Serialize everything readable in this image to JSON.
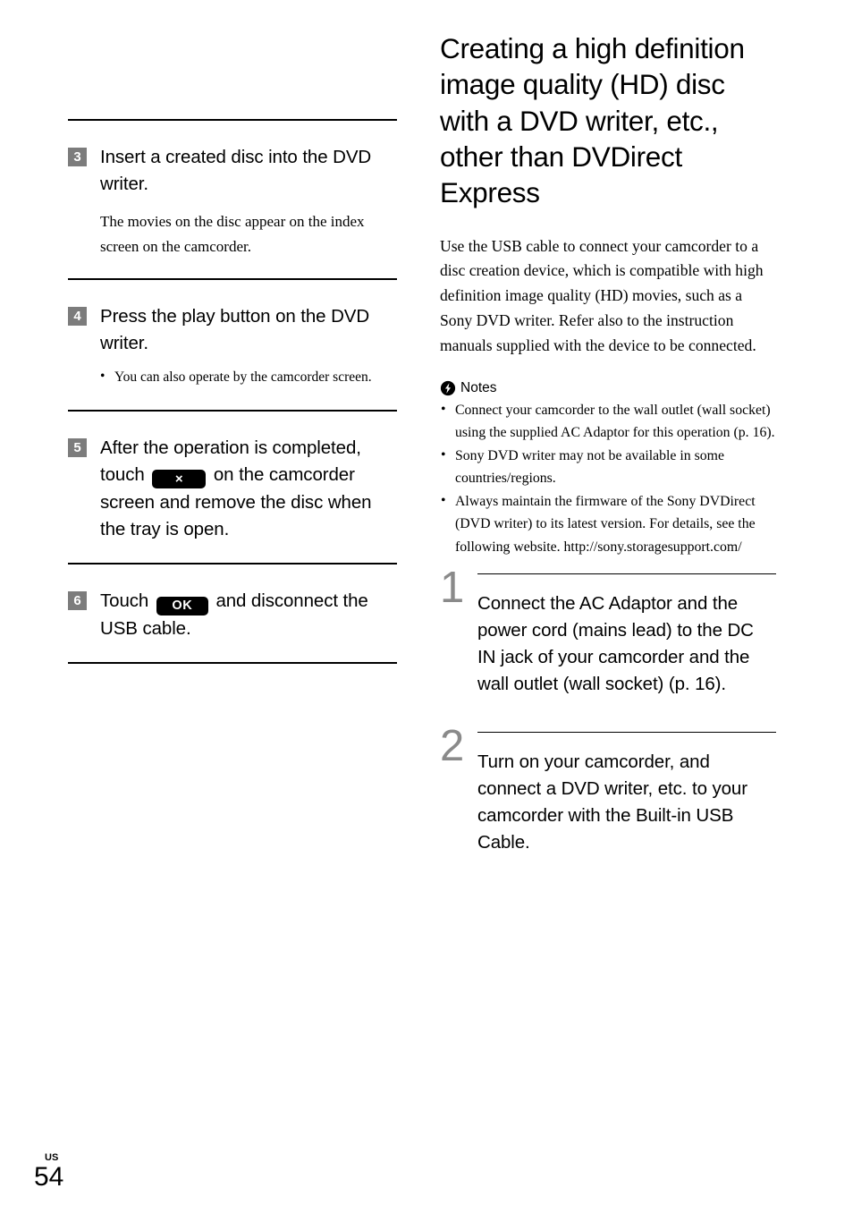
{
  "document": {
    "page_number": "54",
    "region_code": "US"
  },
  "left_column": {
    "steps": [
      {
        "number": "3",
        "heading": "Insert a created disc into the DVD writer.",
        "body": "The movies on the disc appear on the index screen on the camcorder.",
        "bullets": []
      },
      {
        "number": "4",
        "heading": "Press the play button on the DVD writer.",
        "body": "",
        "bullets": [
          "You can also operate by the camcorder screen."
        ]
      },
      {
        "number": "5",
        "heading_part1": "After the operation is completed, touch",
        "key_label": "×",
        "key_name": "close-key",
        "heading_part2": "on the camcorder screen and remove the disc when the tray is open.",
        "body": "",
        "bullets": []
      },
      {
        "number": "6",
        "heading_part1": "Touch",
        "key_label": "OK",
        "key_name": "ok-key",
        "heading_part2": "and disconnect the USB cable.",
        "body": "",
        "bullets": []
      }
    ]
  },
  "right_column": {
    "title": "Creating a high definition image quality (HD) disc with a DVD writer, etc., other than DVDirect Express",
    "intro": "Use the USB cable to connect your camcorder to a disc creation device, which is compatible with high definition image quality (HD) movies, such as a Sony DVD writer. Refer also to the instruction manuals supplied with the device to be connected.",
    "notes": {
      "icon": "lightning-bolt-icon",
      "label": "Notes",
      "items": [
        "Connect your camcorder to the wall outlet (wall socket) using the supplied AC Adaptor for this operation (p. 16).",
        "Sony DVD writer may not be available in some countries/regions.",
        "Always maintain the firmware of the Sony DVDirect (DVD writer) to its latest version. For details, see the following website. http://sony.storagesupport.com/"
      ],
      "website": "http://sony.storagesupport.com/"
    },
    "steps": [
      {
        "number": "1",
        "text": "Connect the AC Adaptor and the power cord (mains lead) to the DC IN jack of your camcorder and the wall outlet (wall socket) (p. 16)."
      },
      {
        "number": "2",
        "text": "Turn on your camcorder, and connect a DVD writer, etc. to your camcorder with the Built-in USB Cable."
      }
    ]
  },
  "colors": {
    "badge_gray": "#7c7c7c",
    "big_number_gray": "#8a8a8a",
    "key_black": "#000000",
    "text_black": "#000000"
  }
}
